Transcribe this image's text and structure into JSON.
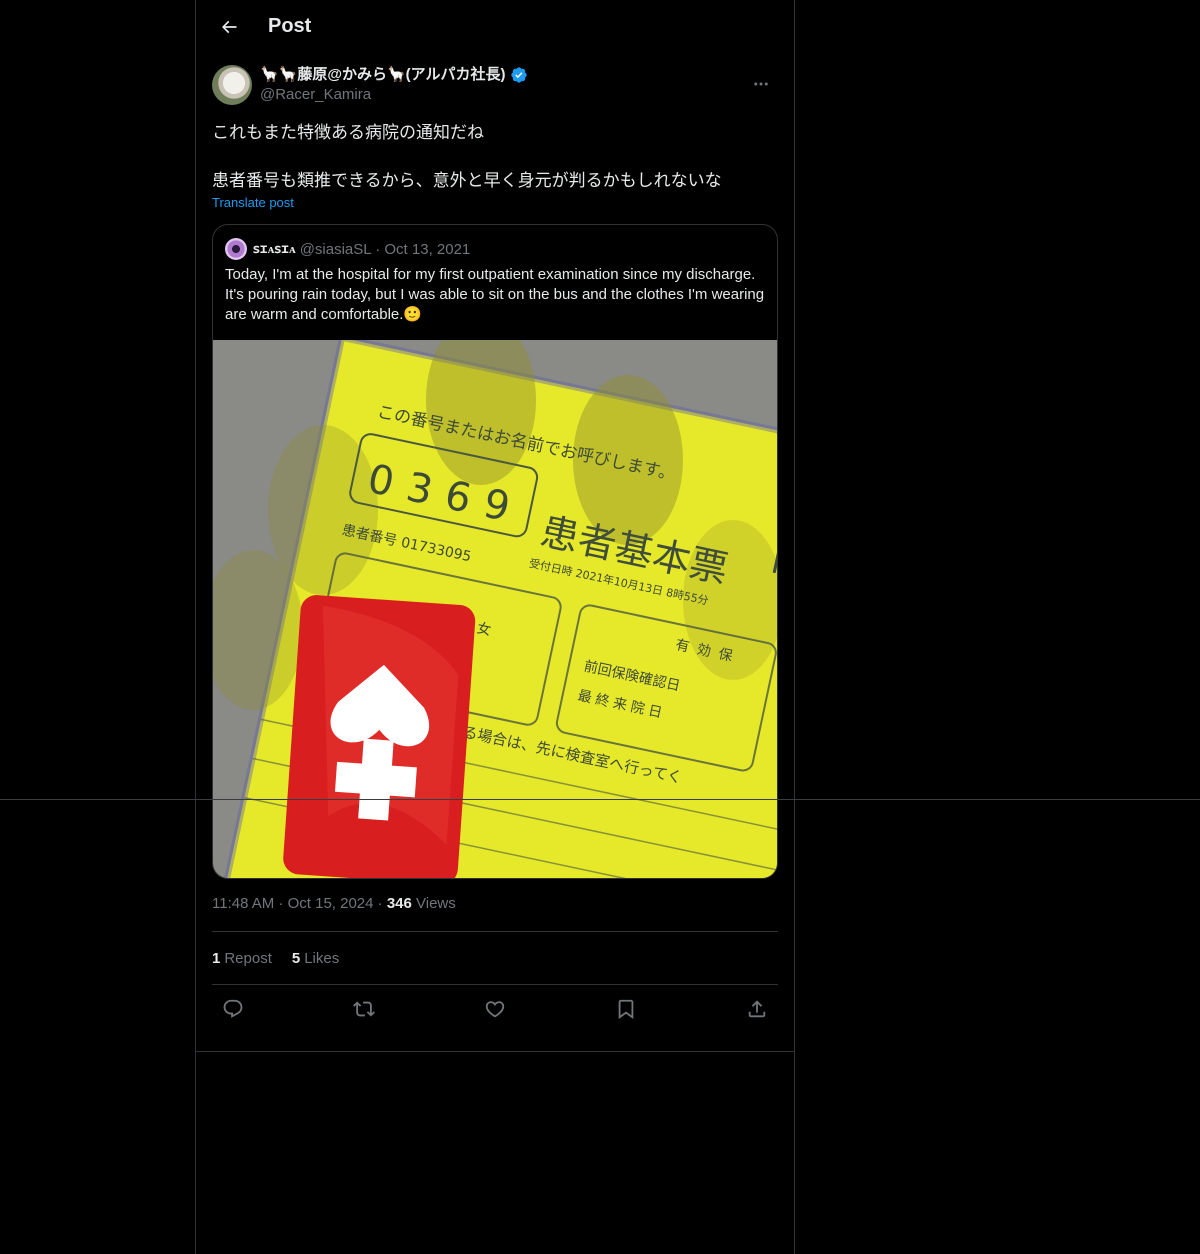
{
  "header": {
    "title": "Post"
  },
  "post": {
    "author": {
      "display_name": "🦙🦙藤原@かみら🦙(アルパカ社長)",
      "handle": "@Racer_Kamira"
    },
    "text": "これもまた特徴ある病院の通知だね\n\n患者番号も類推できるから、意外と早く身元が判るかもしれないな",
    "translate_label": "Translate post",
    "quote": {
      "name": "ꜱɪᴀꜱɪᴀ",
      "meta": "@siasiaSL · Oct 13, 2021",
      "text": "Today, I'm at the hospital for my first outpatient examination since my discharge.\nIt's pouring rain today, but I was able to sit on the bus and the clothes I'm wearing are warm and comfortable.🙂",
      "image": {
        "heading_text": "この番号またはお名前でお呼びします。",
        "number": "0369",
        "form_title": "患者基本票",
        "patient_label": "患者番号 01733095",
        "date_line": "受付日時 2021年10月13日 8時55分",
        "sex_line": "性別 女",
        "insurance_lines": [
          "有効保",
          "前回保険確認日",
          "最終来院日"
        ],
        "bottom_text": "がある場合は、先に検査室へ行ってく"
      }
    },
    "timestamp": "11:48 AM · Oct 15, 2024 · ",
    "views_count": "346",
    "views_label": " Views",
    "reposts_count": "1",
    "reposts_label": "Repost",
    "likes_count": "5",
    "likes_label": "Likes"
  },
  "icons": {
    "back": "arrow-left-icon",
    "verified": "verified-badge-icon",
    "more": "more-icon",
    "reply": "reply-icon",
    "repost": "repost-icon",
    "like": "heart-icon",
    "bookmark": "bookmark-icon",
    "share": "share-icon"
  },
  "colors": {
    "background": "#000000",
    "text": "#e7e9ea",
    "muted": "#71767b",
    "accent": "#1d9bf0",
    "border": "#2f3336"
  }
}
